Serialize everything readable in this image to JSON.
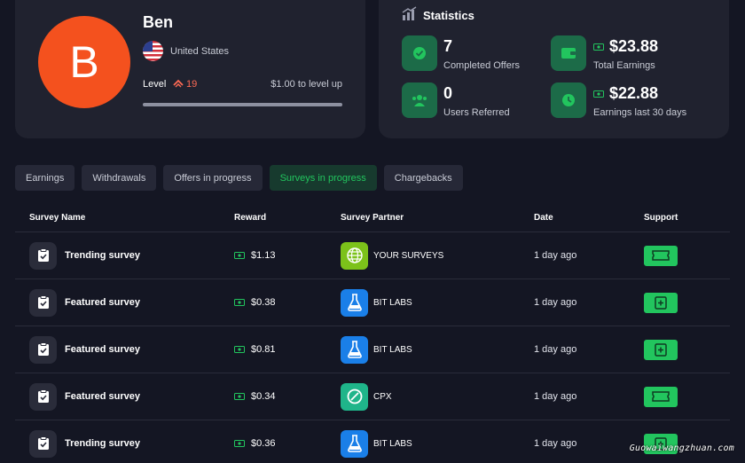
{
  "profile": {
    "avatar_letter": "B",
    "name": "Ben",
    "country": "United States",
    "level_label": "Level",
    "level_value": "19",
    "level_up_text": "$1.00 to level up",
    "level_progress": 0
  },
  "stats": {
    "title": "Statistics",
    "items": [
      {
        "value": "7",
        "label": "Completed Offers",
        "icon": "check-circle-icon",
        "money": false
      },
      {
        "value": "$23.88",
        "label": "Total Earnings",
        "icon": "wallet-icon",
        "money": true
      },
      {
        "value": "0",
        "label": "Users Referred",
        "icon": "users-icon",
        "money": false
      },
      {
        "value": "$22.88",
        "label": "Earnings last 30 days",
        "icon": "clock-icon",
        "money": true
      }
    ]
  },
  "tabs": [
    {
      "label": "Earnings",
      "active": false
    },
    {
      "label": "Withdrawals",
      "active": false
    },
    {
      "label": "Offers in progress",
      "active": false
    },
    {
      "label": "Surveys in progress",
      "active": true
    },
    {
      "label": "Chargebacks",
      "active": false
    }
  ],
  "table": {
    "headers": {
      "name": "Survey Name",
      "reward": "Reward",
      "partner": "Survey Partner",
      "date": "Date",
      "support": "Support"
    },
    "rows": [
      {
        "name": "Trending survey",
        "reward": "$1.13",
        "partner": "YOUR SURVEYS",
        "partner_type": "yoursurveys",
        "date": "1 day ago",
        "support_icon": "ticket-icon"
      },
      {
        "name": "Featured survey",
        "reward": "$0.38",
        "partner": "BIT LABS",
        "partner_type": "bitlabs",
        "date": "1 day ago",
        "support_icon": "clipboard-plus-icon"
      },
      {
        "name": "Featured survey",
        "reward": "$0.81",
        "partner": "BIT LABS",
        "partner_type": "bitlabs",
        "date": "1 day ago",
        "support_icon": "clipboard-plus-icon"
      },
      {
        "name": "Featured survey",
        "reward": "$0.34",
        "partner": "CPX",
        "partner_type": "cpx",
        "date": "1 day ago",
        "support_icon": "ticket-icon"
      },
      {
        "name": "Trending survey",
        "reward": "$0.36",
        "partner": "BIT LABS",
        "partner_type": "bitlabs",
        "date": "1 day ago",
        "support_icon": "clipboard-plus-icon"
      }
    ]
  },
  "watermark": "Guowaiwangzhuan.com",
  "colors": {
    "background": "#141623",
    "card": "#20222f",
    "accent_green": "#22c55e",
    "avatar": "#f4511e",
    "level_red": "#ff6b55",
    "yoursurveys": "#7cc21a",
    "bitlabs": "#1a7fe8",
    "cpx": "#1fb58a"
  }
}
